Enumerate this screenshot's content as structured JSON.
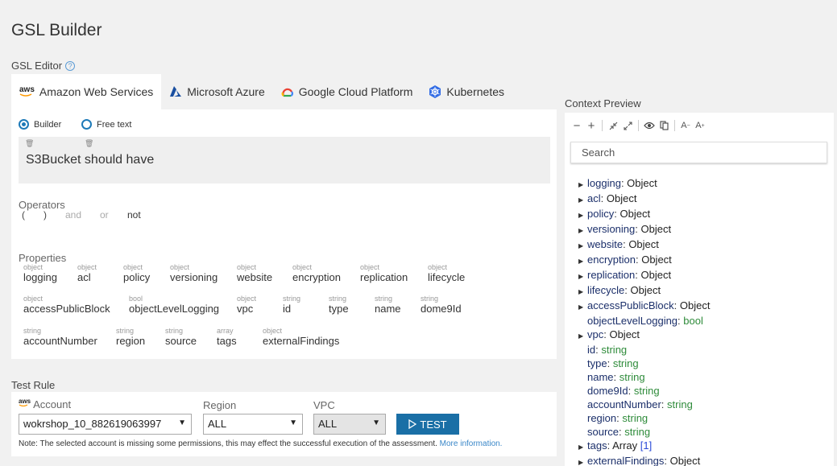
{
  "page_title": "GSL Builder",
  "editor": {
    "heading": "GSL Editor",
    "help_icon": "?",
    "tabs": [
      {
        "icon": "aws",
        "label": "Amazon Web Services"
      },
      {
        "icon": "azure-icon",
        "label": "Microsoft Azure"
      },
      {
        "icon": "gcp-icon",
        "label": "Google Cloud Platform"
      },
      {
        "icon": "kubernetes-icon",
        "label": "Kubernetes"
      }
    ],
    "modes": [
      {
        "label": "Builder",
        "selected": true
      },
      {
        "label": "Free text",
        "selected": false
      }
    ],
    "rule_text": "S3Bucket should have",
    "operators_label": "Operators",
    "operators": [
      "(",
      ")",
      "and",
      "or",
      "not"
    ],
    "properties_label": "Properties",
    "properties": [
      {
        "type": "object",
        "name": "logging"
      },
      {
        "type": "object",
        "name": "acl"
      },
      {
        "type": "object",
        "name": "policy"
      },
      {
        "type": "object",
        "name": "versioning"
      },
      {
        "type": "object",
        "name": "website"
      },
      {
        "type": "object",
        "name": "encryption"
      },
      {
        "type": "object",
        "name": "replication"
      },
      {
        "type": "object",
        "name": "lifecycle"
      },
      {
        "type": "object",
        "name": "accessPublicBlock"
      },
      {
        "type": "bool",
        "name": "objectLevelLogging"
      },
      {
        "type": "object",
        "name": "vpc"
      },
      {
        "type": "string",
        "name": "id"
      },
      {
        "type": "string",
        "name": "type"
      },
      {
        "type": "string",
        "name": "name"
      },
      {
        "type": "string",
        "name": "dome9Id"
      },
      {
        "type": "string",
        "name": "accountNumber"
      },
      {
        "type": "string",
        "name": "region"
      },
      {
        "type": "string",
        "name": "source"
      },
      {
        "type": "array",
        "name": "tags"
      },
      {
        "type": "object",
        "name": "externalFindings"
      }
    ]
  },
  "test_rule": {
    "heading": "Test Rule",
    "account_icon": "aws",
    "account_label": "Account",
    "account_value": "wokrshop_10_882619063997",
    "region_label": "Region",
    "region_value": "ALL",
    "vpc_label": "VPC",
    "vpc_value": "ALL",
    "test_button": "TEST",
    "note": "Note: The selected account is missing some permissions, this may effect the successful execution of the assessment.",
    "note_link": "More information."
  },
  "context_preview": {
    "title": "Context Preview",
    "search_placeholder": "Search",
    "nodes": [
      {
        "key": "logging",
        "value": "Object",
        "expandable": true
      },
      {
        "key": "acl",
        "value": "Object",
        "expandable": true
      },
      {
        "key": "policy",
        "value": "Object",
        "expandable": true
      },
      {
        "key": "versioning",
        "value": "Object",
        "expandable": true
      },
      {
        "key": "website",
        "value": "Object",
        "expandable": true
      },
      {
        "key": "encryption",
        "value": "Object",
        "expandable": true
      },
      {
        "key": "replication",
        "value": "Object",
        "expandable": true
      },
      {
        "key": "lifecycle",
        "value": "Object",
        "expandable": true
      },
      {
        "key": "accessPublicBlock",
        "value": "Object",
        "expandable": true
      },
      {
        "key": "objectLevelLogging",
        "value": "bool",
        "expandable": false
      },
      {
        "key": "vpc",
        "value": "Object",
        "expandable": true
      },
      {
        "key": "id",
        "value": "string",
        "expandable": false
      },
      {
        "key": "type",
        "value": "string",
        "expandable": false
      },
      {
        "key": "name",
        "value": "string",
        "expandable": false
      },
      {
        "key": "dome9Id",
        "value": "string",
        "expandable": false
      },
      {
        "key": "accountNumber",
        "value": "string",
        "expandable": false
      },
      {
        "key": "region",
        "value": "string",
        "expandable": false
      },
      {
        "key": "source",
        "value": "string",
        "expandable": false
      },
      {
        "key": "tags",
        "value": "Array",
        "count": "[1]",
        "expandable": true
      },
      {
        "key": "externalFindings",
        "value": "Object",
        "expandable": true
      }
    ]
  },
  "colors": {
    "accent": "#1a6fa6",
    "radio": "#1e7ab8",
    "tree_key": "#1b2f6a",
    "tree_type": "#2e8b3a",
    "link": "#3a87c8"
  }
}
